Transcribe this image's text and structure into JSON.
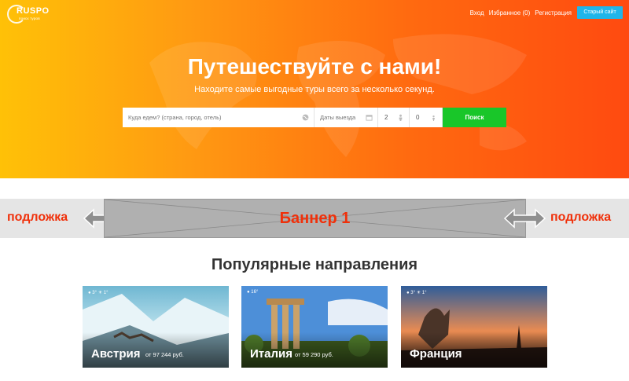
{
  "header": {
    "logo_text": "RUSPO",
    "logo_sub": "поиск туров",
    "nav": [
      {
        "label": "Вход"
      },
      {
        "label": "Избранное (0)"
      },
      {
        "label": "Регистрация"
      }
    ],
    "old_site_label": "Старый сайт"
  },
  "hero": {
    "title": "Путешествуйте с нами!",
    "subtitle": "Находите самые выгодные туры всего за несколько секунд."
  },
  "search": {
    "destination_placeholder": "Куда едем? (страна, город, отель)",
    "dates_placeholder": "Даты выезда",
    "adults_value": "2",
    "kids_value": "0",
    "button_label": "Поиск"
  },
  "banner": {
    "label": "Баннер 1",
    "left_label": "подложка",
    "right_label": "подложка"
  },
  "popular": {
    "title": "Популярные направления",
    "cards": [
      {
        "country": "Австрия",
        "price": "от 97 244 руб.",
        "weather": "● 3° ☀ 1°"
      },
      {
        "country": "Италия",
        "price": "от 59 290 руб.",
        "weather": "● 16°"
      },
      {
        "country": "Франция",
        "price": "",
        "weather": "● 3° ☀ 1°"
      }
    ]
  },
  "colors": {
    "accent_green": "#19c629",
    "accent_blue": "#1fb5ea",
    "label_red": "#f0300a"
  }
}
